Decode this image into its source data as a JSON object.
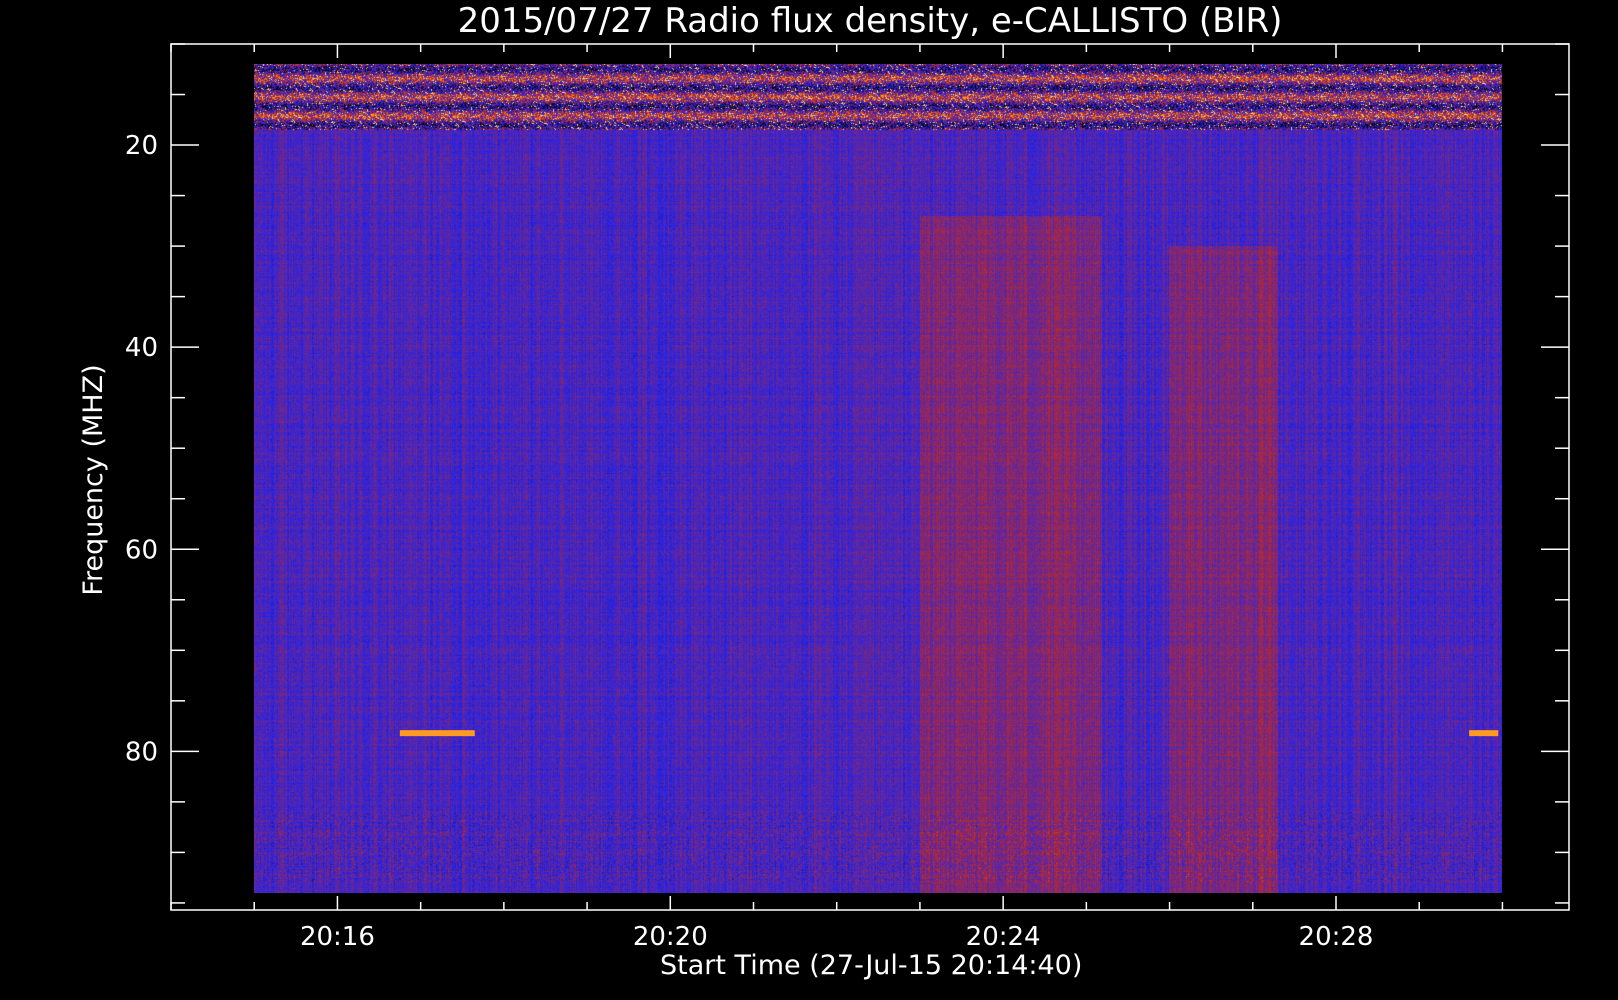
{
  "chart_data": {
    "type": "heatmap",
    "title": "2015/07/27  Radio flux density, e-CALLISTO (BIR)",
    "xlabel": "Start Time (27-Jul-15 20:14:40)",
    "ylabel": "Frequency (MHZ)",
    "x_axis": {
      "unit": "minutes after 20:00",
      "range": [
        14.0,
        30.8
      ],
      "data_extent": [
        15.0,
        30.0
      ],
      "major_ticks": [
        {
          "value": 16,
          "label": "20:16"
        },
        {
          "value": 20,
          "label": "20:20"
        },
        {
          "value": 24,
          "label": "20:24"
        },
        {
          "value": 28,
          "label": "20:28"
        }
      ],
      "minor_step": 1
    },
    "y_axis": {
      "unit": "MHz",
      "inverted": true,
      "range": [
        10.0,
        95.7
      ],
      "data_extent": [
        12.0,
        94.0
      ],
      "major_ticks": [
        {
          "value": 20,
          "label": "20"
        },
        {
          "value": 40,
          "label": "40"
        },
        {
          "value": 60,
          "label": "60"
        },
        {
          "value": 80,
          "label": "80"
        }
      ],
      "minor_step": 5
    },
    "colormap": {
      "low": "#000000",
      "background": "#2424ee",
      "mid": "#cc2a10",
      "high": "#ff9a22",
      "peak": "#fff2b0"
    },
    "features": [
      {
        "kind": "interference_band",
        "freq_range": [
          12.0,
          18.5
        ],
        "time_range": [
          15.0,
          30.0
        ],
        "intensity": "high"
      },
      {
        "kind": "enhanced_emission",
        "freq_range": [
          27.0,
          94.0
        ],
        "time_range": [
          23.0,
          25.2
        ],
        "intensity": "moderate"
      },
      {
        "kind": "enhanced_emission",
        "freq_range": [
          30.0,
          94.0
        ],
        "time_range": [
          26.0,
          27.3
        ],
        "intensity": "moderate"
      },
      {
        "kind": "narrowband_line",
        "freq": 78.2,
        "time_range": [
          16.75,
          17.65
        ],
        "intensity": "peak"
      },
      {
        "kind": "narrowband_line",
        "freq": 78.2,
        "time_range": [
          29.6,
          29.95
        ],
        "intensity": "peak"
      }
    ],
    "grid": false,
    "legend": "none"
  }
}
